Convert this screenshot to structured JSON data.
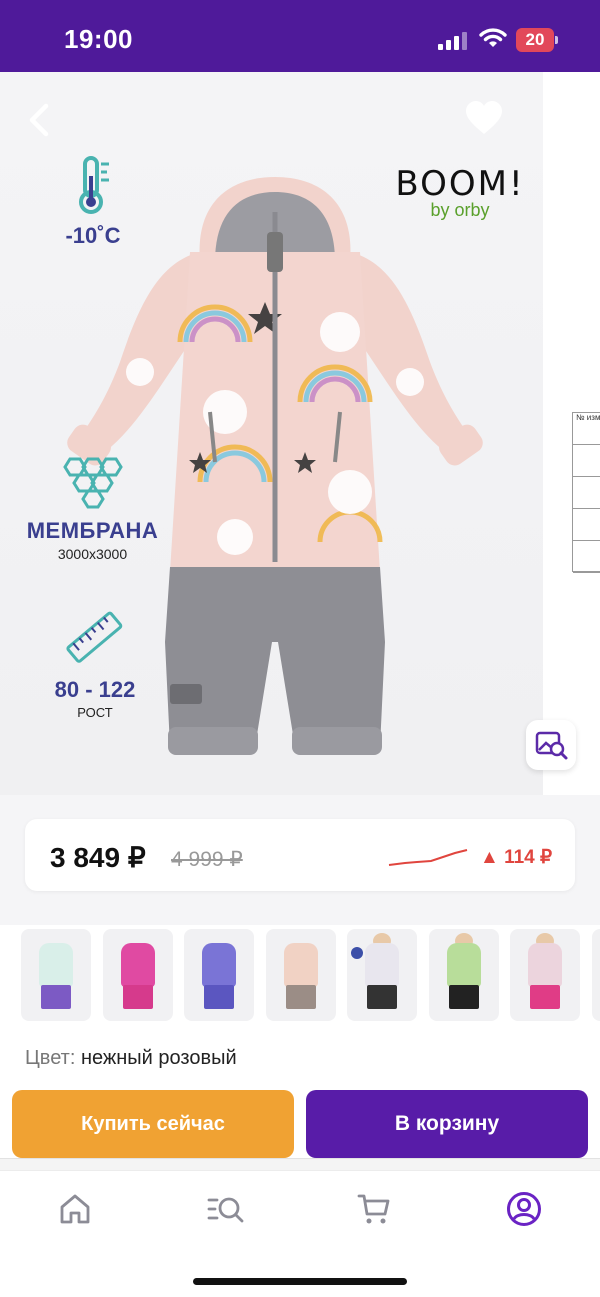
{
  "status_bar": {
    "time": "19:00",
    "battery_level": "20",
    "bg_color": "#4f1a9a"
  },
  "product_image": {
    "temperature": "-10˚C",
    "membrane_title": "МЕМБРАНА",
    "membrane_rating": "3000x3000",
    "height_range": "80 - 122",
    "height_label": "РОСТ",
    "brand_name": "BOOM!",
    "brand_sub": "by orby",
    "size_table_header": "№ изм"
  },
  "price": {
    "current": "3 849 ₽",
    "old": "4 999 ₽",
    "change": "▲ 114 ₽",
    "change_color": "#e0453e"
  },
  "thumbnails": [
    {
      "name": "mint",
      "color": "#d9efe9",
      "legs": "#7c5ac4"
    },
    {
      "name": "pink",
      "color": "#e04aa2",
      "legs": "#d63a8c"
    },
    {
      "name": "purple",
      "color": "#7a74d6",
      "legs": "#5b56c0"
    },
    {
      "name": "soft-pink",
      "color": "#f1d2c4",
      "legs": "#9b8d86"
    },
    {
      "name": "photo-white",
      "color": "#e8e6ee",
      "legs": "#333"
    },
    {
      "name": "photo-green",
      "color": "#b8dd9a",
      "legs": "#222"
    },
    {
      "name": "photo-pink",
      "color": "#ecd4dd",
      "legs": "#e03c86"
    }
  ],
  "color_info": {
    "label": "Цвет:",
    "value": "нежный розовый"
  },
  "actions": {
    "buy_now": "Купить сейчас",
    "add_to_cart": "В корзину"
  },
  "bottom_nav": [
    {
      "icon": "home-icon"
    },
    {
      "icon": "catalog-search-icon"
    },
    {
      "icon": "cart-icon"
    },
    {
      "icon": "profile-icon",
      "active": true
    }
  ],
  "colors": {
    "accent_purple": "#581ca8",
    "accent_orange": "#f0a233"
  }
}
